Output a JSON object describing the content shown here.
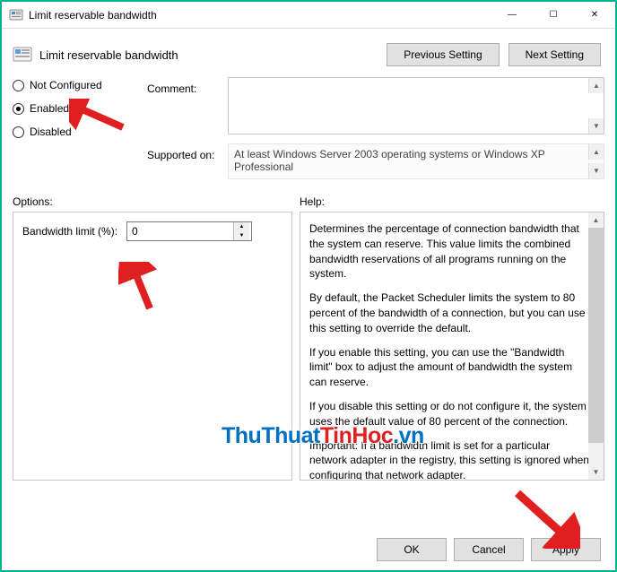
{
  "window": {
    "title": "Limit reservable bandwidth",
    "minimize": "—",
    "maximize": "☐",
    "close": "✕"
  },
  "header": {
    "title": "Limit reservable bandwidth"
  },
  "nav": {
    "previous": "Previous Setting",
    "next": "Next Setting"
  },
  "radios": {
    "not_configured": "Not Configured",
    "enabled": "Enabled",
    "disabled": "Disabled",
    "selected": "enabled"
  },
  "fields": {
    "comment_label": "Comment:",
    "comment_value": "",
    "supported_label": "Supported on:",
    "supported_value": "At least Windows Server 2003 operating systems or Windows XP Professional"
  },
  "sections": {
    "options": "Options:",
    "help": "Help:"
  },
  "options_panel": {
    "bandwidth_label": "Bandwidth limit (%):",
    "bandwidth_value": "0"
  },
  "help_panel": {
    "p1": "Determines the percentage of connection bandwidth that the system can reserve. This value limits the combined bandwidth reservations of all programs running on the system.",
    "p2": "By default, the Packet Scheduler limits the system to 80 percent of the bandwidth of a connection, but you can use this setting to override the default.",
    "p3": "If you enable this setting, you can use the \"Bandwidth limit\" box to adjust the amount of bandwidth the system can reserve.",
    "p4": "If you disable this setting or do not configure it, the system uses the default value of 80 percent of the connection.",
    "p5": "Important: If a bandwidth limit is set for a particular network adapter in the registry, this setting is ignored when configuring that network adapter."
  },
  "footer": {
    "ok": "OK",
    "cancel": "Cancel",
    "apply": "Apply"
  },
  "watermark": {
    "a": "ThuThuat",
    "b": "TinHoc",
    "c": ".vn"
  }
}
